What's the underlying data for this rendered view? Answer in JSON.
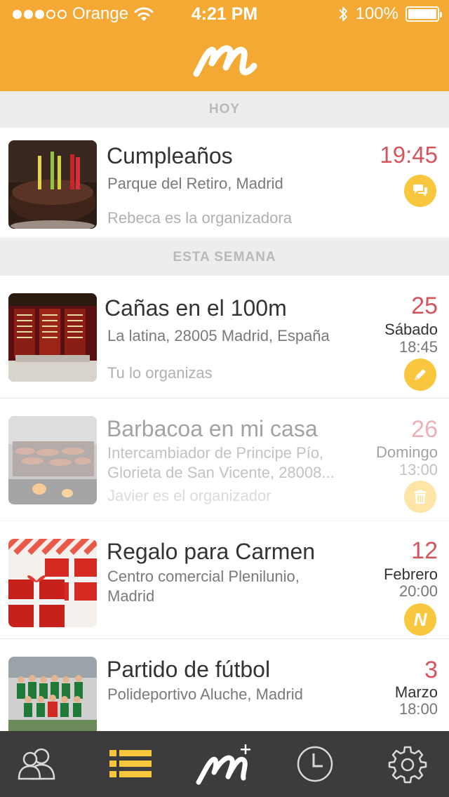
{
  "status_bar": {
    "carrier": "Orange",
    "time": "4:21 PM",
    "battery": "100%"
  },
  "colors": {
    "brand": "#f4a935",
    "accent_date": "#d4555e",
    "badge": "#f9c73e",
    "tabbar": "#3c3c3c",
    "tab_active": "#f9c73e"
  },
  "header": {
    "logo": "m-logo-icon"
  },
  "sections": {
    "today": "HOY",
    "this_week": "ESTA SEMANA"
  },
  "events": [
    {
      "title": "Cumpleaños",
      "place": "Parque del Retiro, Madrid",
      "organizer": "Rebeca es la organizadora",
      "time": "19:45",
      "badge_icon": "chat-icon"
    },
    {
      "title": "Cañas en el 100m",
      "place": "La latina, 28005 Madrid, España",
      "organizer": "Tu lo organizas",
      "day": "25",
      "weekday": "Sábado",
      "hour": "18:45",
      "badge_icon": "pencil-icon"
    },
    {
      "title": "Barbacoa en mi casa",
      "place": "Intercambiador de Principe Pío, Glorieta de San Vicente, 28008...",
      "organizer": "Javier es el organizador",
      "day": "26",
      "weekday": "Domingo",
      "hour": "13:00",
      "badge_icon": "trash-icon"
    },
    {
      "title": "Regalo para Carmen",
      "place": "Centro comercial Plenilunio, Madrid",
      "organizer": "",
      "day": "12",
      "weekday": "Febrero",
      "hour": "20:00",
      "badge_text": "N"
    },
    {
      "title": "Partido de fútbol",
      "place": "Polideportivo Aluche, Madrid",
      "organizer": "",
      "day": "3",
      "weekday": "Marzo",
      "hour": "18:00"
    }
  ],
  "tabbar": {
    "tabs": [
      {
        "icon": "contacts-icon",
        "active": false
      },
      {
        "icon": "list-icon",
        "active": true
      },
      {
        "icon": "new-event-icon",
        "active": false
      },
      {
        "icon": "clock-icon",
        "active": false
      },
      {
        "icon": "gear-icon",
        "active": false
      }
    ]
  }
}
